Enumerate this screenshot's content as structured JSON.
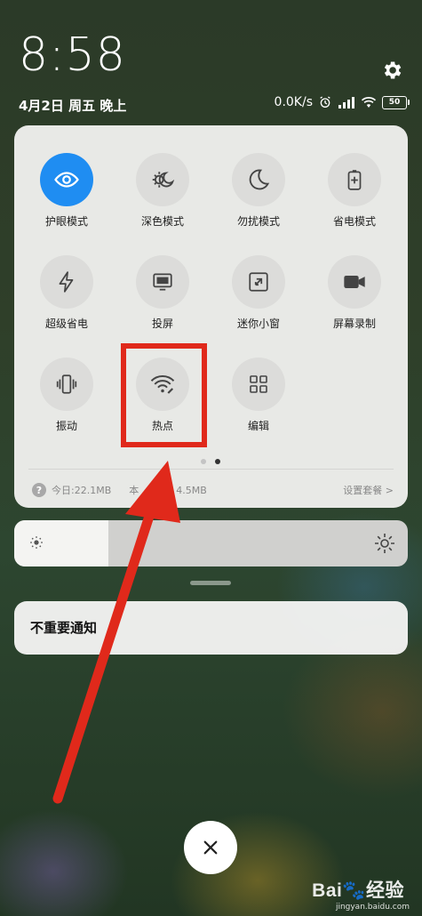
{
  "status_bar": {
    "time": "8:58",
    "date": "4月2日 周五 晚上",
    "net_speed": "0.0K/s",
    "battery": "50"
  },
  "quick_settings": {
    "tiles": [
      {
        "label": "护眼模式",
        "icon": "eye-icon",
        "active": true
      },
      {
        "label": "深色模式",
        "icon": "dark-mode-icon",
        "active": false
      },
      {
        "label": "勿扰模式",
        "icon": "moon-icon",
        "active": false
      },
      {
        "label": "省电模式",
        "icon": "battery-saver-icon",
        "active": false
      },
      {
        "label": "超级省电",
        "icon": "lightning-icon",
        "active": false
      },
      {
        "label": "投屏",
        "icon": "cast-screen-icon",
        "active": false
      },
      {
        "label": "迷你小窗",
        "icon": "mini-window-icon",
        "active": false
      },
      {
        "label": "屏幕录制",
        "icon": "video-camera-icon",
        "active": false
      },
      {
        "label": "振动",
        "icon": "vibrate-icon",
        "active": false
      },
      {
        "label": "热点",
        "icon": "hotspot-icon",
        "active": false
      },
      {
        "label": "编辑",
        "icon": "grid-edit-icon",
        "active": false
      }
    ],
    "page_dots": {
      "count": 2,
      "active_index": 1
    },
    "data_usage": {
      "today": "今日:22.1MB",
      "month": "本",
      "month_value": "4.5MB"
    },
    "settings_link": "设置套餐 >"
  },
  "brightness": {
    "level": 0.24
  },
  "notifications": {
    "group_label": "不重要通知"
  },
  "colors": {
    "accent_blue": "#1f8df2",
    "annotation_red": "#e0291b"
  },
  "watermark": {
    "brand": "Bai",
    "brand_suffix": "经验",
    "url": "jingyan.baidu.com"
  }
}
